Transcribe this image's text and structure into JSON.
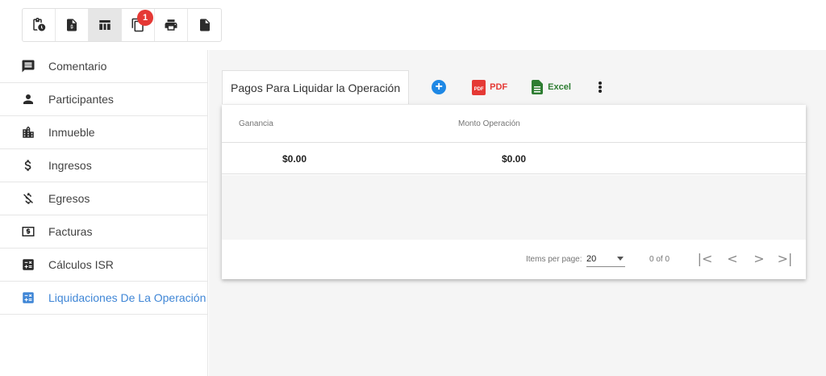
{
  "toolbar": {
    "buttons": [
      {
        "icon": "clipboard-clock-icon"
      },
      {
        "icon": "file-dollar-icon"
      },
      {
        "icon": "table-icon",
        "active": true
      },
      {
        "icon": "copy-icon",
        "badge": "1"
      },
      {
        "icon": "print-icon"
      },
      {
        "icon": "file-icon"
      }
    ]
  },
  "sidebar": {
    "items": [
      {
        "label": "Comentario",
        "icon": "comment-icon"
      },
      {
        "label": "Participantes",
        "icon": "person-icon"
      },
      {
        "label": "Inmueble",
        "icon": "building-icon"
      },
      {
        "label": "Ingresos",
        "icon": "dollar-icon"
      },
      {
        "label": "Egresos",
        "icon": "money-off-icon"
      },
      {
        "label": "Facturas",
        "icon": "invoice-icon"
      },
      {
        "label": "Cálculos ISR",
        "icon": "calculator-icon"
      },
      {
        "label": "Liquidaciones De La Operación",
        "icon": "calculator-icon",
        "active": true
      }
    ]
  },
  "main": {
    "tab_label": "Pagos Para Liquidar la Operación",
    "pdf_label": "PDF",
    "pdf_icon_text": "PDF",
    "excel_label": "Excel",
    "table": {
      "columns": [
        "Ganancia",
        "Monto Operación"
      ],
      "rows": [
        [
          "$0.00",
          "$0.00"
        ]
      ]
    },
    "paginator": {
      "items_per_page_label": "Items per page:",
      "page_size": "20",
      "range_label": "0 of 0"
    }
  },
  "colors": {
    "accent_blue": "#3f86d6",
    "pdf_red": "#e53935",
    "excel_green": "#2e7d32",
    "badge_red": "#e53935"
  }
}
